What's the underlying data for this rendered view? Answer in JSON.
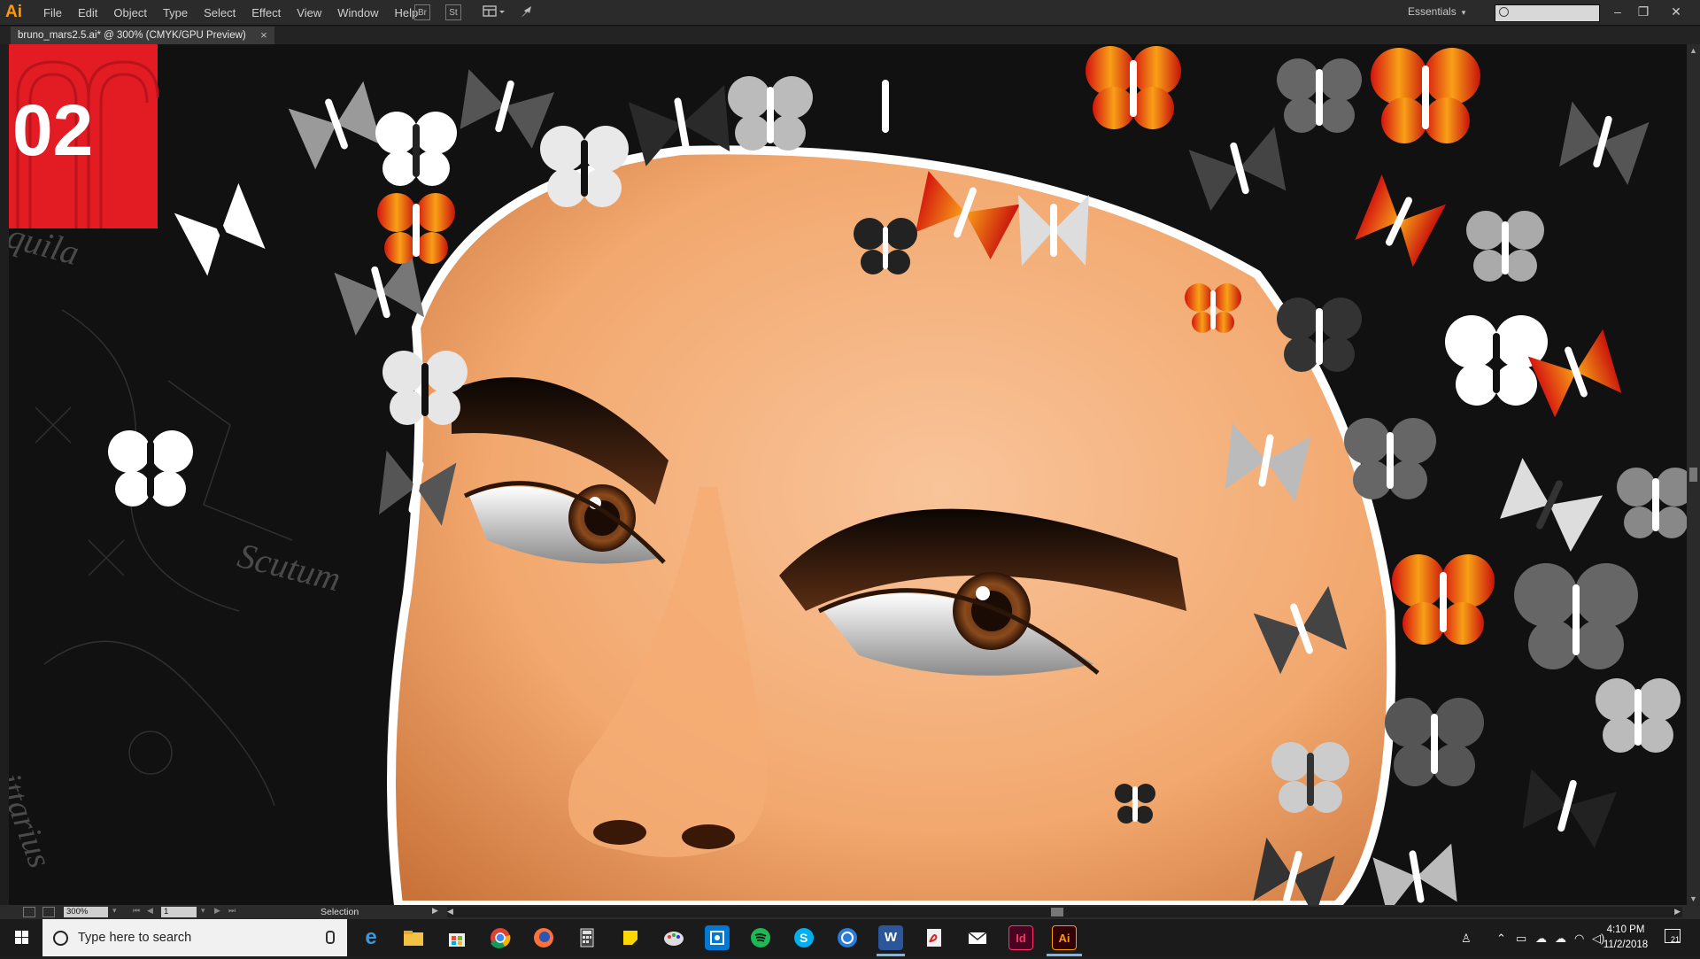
{
  "app": {
    "logo": "Ai",
    "menu": [
      "File",
      "Edit",
      "Object",
      "Type",
      "Select",
      "Effect",
      "View",
      "Window",
      "Help"
    ],
    "toolbar_buttons": [
      "Br",
      "St"
    ],
    "workspace": "Essentials",
    "search_placeholder": ""
  },
  "document": {
    "tab_title": "bruno_mars2.5.ai* @ 300% (CMYK/GPU Preview)",
    "close_glyph": "×"
  },
  "artwork": {
    "badge_number": "02",
    "constellation_labels": [
      "quila",
      "Scutum",
      "ittarius"
    ],
    "colors": {
      "background": "#111111",
      "badge": "#e31b23",
      "skin": "#f6b98a",
      "butterfly_red": "#e8471d",
      "butterfly_gray": "#8a8a8a"
    }
  },
  "statusbar": {
    "zoom": "300%",
    "page": "1",
    "current_tool": "Selection"
  },
  "taskbar": {
    "search_placeholder": "Type here to search",
    "apps": [
      "edge-icon",
      "file-explorer-icon",
      "store-icon",
      "chrome-icon",
      "firefox-icon",
      "calculator-icon",
      "sticky-notes-icon",
      "paint-icon",
      "outlook-icon",
      "spotify-icon",
      "skype-icon",
      "browser-icon",
      "word-icon",
      "acrobat-icon",
      "mail-icon",
      "indesign-icon",
      "illustrator-icon"
    ],
    "indesign_label": "Id",
    "illustrator_label": "Ai",
    "word_label": "W",
    "time": "4:10 PM",
    "date": "11/2/2018",
    "notification_count": "21"
  }
}
